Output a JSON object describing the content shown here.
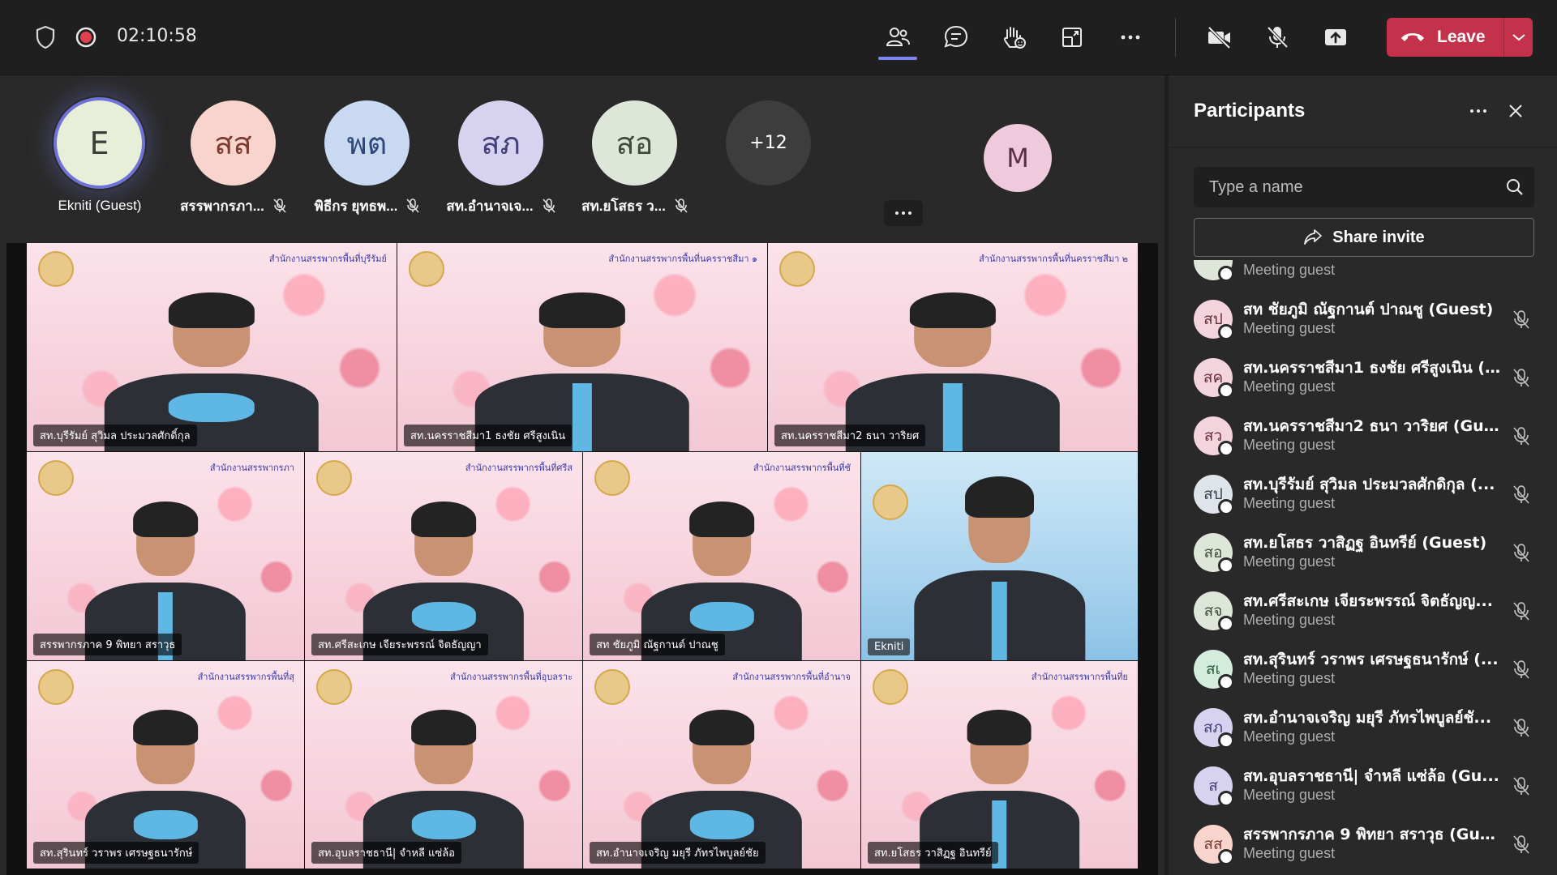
{
  "topbar": {
    "timer": "02:10:58",
    "leave_label": "Leave"
  },
  "avatar_row": [
    {
      "initials": "E",
      "label": "Ekniti (Guest)",
      "bg": "#e8efd8",
      "fg": "#3d3d3d",
      "muted": false
    },
    {
      "initials": "สส",
      "label": "สรรพากรภา...",
      "bg": "#f8d4cc",
      "fg": "#7a3b30",
      "muted": true
    },
    {
      "initials": "พต",
      "label": "พิธีกร ยุทธพ...",
      "bg": "#c9d9f2",
      "fg": "#2f4a7a",
      "muted": true
    },
    {
      "initials": "สภ",
      "label": "สท.อำนาจเจ...",
      "bg": "#d6d2ef",
      "fg": "#44407a",
      "muted": true
    },
    {
      "initials": "สอ",
      "label": "สท.ยโสธร ว...",
      "bg": "#dde6d8",
      "fg": "#3d4d38",
      "muted": true
    },
    {
      "initials": "+12",
      "label": "",
      "bg": "#3d3d3d",
      "fg": "#ffffff",
      "muted": false
    }
  ],
  "spotlight_avatar": {
    "initials": "M"
  },
  "video_tiles": [
    {
      "name": "สท.บุรีรัมย์ สุวิมล ประมวลศักดิ์กุล",
      "banner": "สำนักงานสรรพากรพื้นที่บุรีรัมย์"
    },
    {
      "name": "สท.นครราชสีมา1 ธงชัย ศรีสูงเนิน",
      "banner": "สำนักงานสรรพากรพื้นที่นครราชสีมา ๑"
    },
    {
      "name": "สท.นครราชสีมา2 ธนา วาริยศ",
      "banner": "สำนักงานสรรพากรพื้นที่นครราชสีมา ๒"
    },
    {
      "name": "สรรพากรภาค 9 พิทยา สราวุธ",
      "banner": "สำนักงานสรรพากรภา"
    },
    {
      "name": "สท.ศรีสะเกษ เจียระพรรณ์ จิตธัญญา",
      "banner": "สำนักงานสรรพากรพื้นที่ศรีส"
    },
    {
      "name": "สท ชัยภูมิ ณัฐกานต์ ปาณชู",
      "banner": "สำนักงานสรรพากรพื้นที่ชั"
    },
    {
      "name": "Ekniti",
      "banner": ""
    },
    {
      "name": "สท.สุรินทร์ วราพร เศรษฐธนารักษ์",
      "banner": "สำนักงานสรรพากรพื้นที่สุ"
    },
    {
      "name": "สท.อุบลราชธานี| จำหลี แซ่ล้อ",
      "banner": "สำนักงานสรรพากรพื้นที่อุบลราะ"
    },
    {
      "name": "สท.อำนาจเจริญ มยุรี ภัทรไพบูลย์ชัย",
      "banner": "สำนักงานสรรพากรพื้นที่อำนาจ"
    },
    {
      "name": "สท.ยโสธร วาสิฏฐ อินทรีย์",
      "banner": "สำนักงานสรรพากรพื้นที่ย"
    }
  ],
  "panel": {
    "title": "Participants",
    "search_placeholder": "Type a name",
    "share_label": "Share invite",
    "partial_top_subtitle": "Meeting guest",
    "participants": [
      {
        "initials": "สป",
        "name": "สท ชัยภูมิ ณัฐกานต์ ปาณชู (Guest)",
        "subtitle": "Meeting guest",
        "bg": "#f3d3dc",
        "fg": "#6a2b3d"
      },
      {
        "initials": "สค",
        "name": "สท.นครราชสีมา1 ธงชัย ศรีสูงเนิน (...",
        "subtitle": "Meeting guest",
        "bg": "#f3d3dc",
        "fg": "#6a2b3d"
      },
      {
        "initials": "สว",
        "name": "สท.นครราชสีมา2 ธนา วาริยศ (Gue...",
        "subtitle": "Meeting guest",
        "bg": "#f3d3dc",
        "fg": "#6a2b3d"
      },
      {
        "initials": "สป",
        "name": "สท.บุรีรัมย์ สุวิมล ประมวลศักดิกุล (...",
        "subtitle": "Meeting guest",
        "bg": "#dfe4ea",
        "fg": "#35414d"
      },
      {
        "initials": "สอ",
        "name": "สท.ยโสธร วาสิฏฐ อินทรีย์ (Guest)",
        "subtitle": "Meeting guest",
        "bg": "#dde6d8",
        "fg": "#3d4d38"
      },
      {
        "initials": "สจ",
        "name": "สท.ศรีสะเกษ เจียระพรรณ์ จิตธัญญ...",
        "subtitle": "Meeting guest",
        "bg": "#dde6d8",
        "fg": "#3d4d38"
      },
      {
        "initials": "สเ",
        "name": "สท.สุรินทร์ วราพร เศรษฐธนารักษ์ (...",
        "subtitle": "Meeting guest",
        "bg": "#d4ecdc",
        "fg": "#2d5a3c"
      },
      {
        "initials": "สภ",
        "name": "สท.อำนาจเจริญ มยุรี ภัทรไพบูลย์ชั...",
        "subtitle": "Meeting guest",
        "bg": "#d6d2ef",
        "fg": "#44407a"
      },
      {
        "initials": "ส",
        "name": "สท.อุบลราชธานี| จำหลี แซ่ล้อ (Gu...",
        "subtitle": "Meeting guest",
        "bg": "#d6d2ef",
        "fg": "#44407a"
      },
      {
        "initials": "สส",
        "name": "สรรพากรภาค 9 พิทยา สราวุธ (Gue...",
        "subtitle": "Meeting guest",
        "bg": "#f8d4cc",
        "fg": "#7a3b30"
      }
    ]
  },
  "colors": {
    "accent": "#7f85f5",
    "leave": "#c4314b",
    "recording": "#e0414f"
  }
}
